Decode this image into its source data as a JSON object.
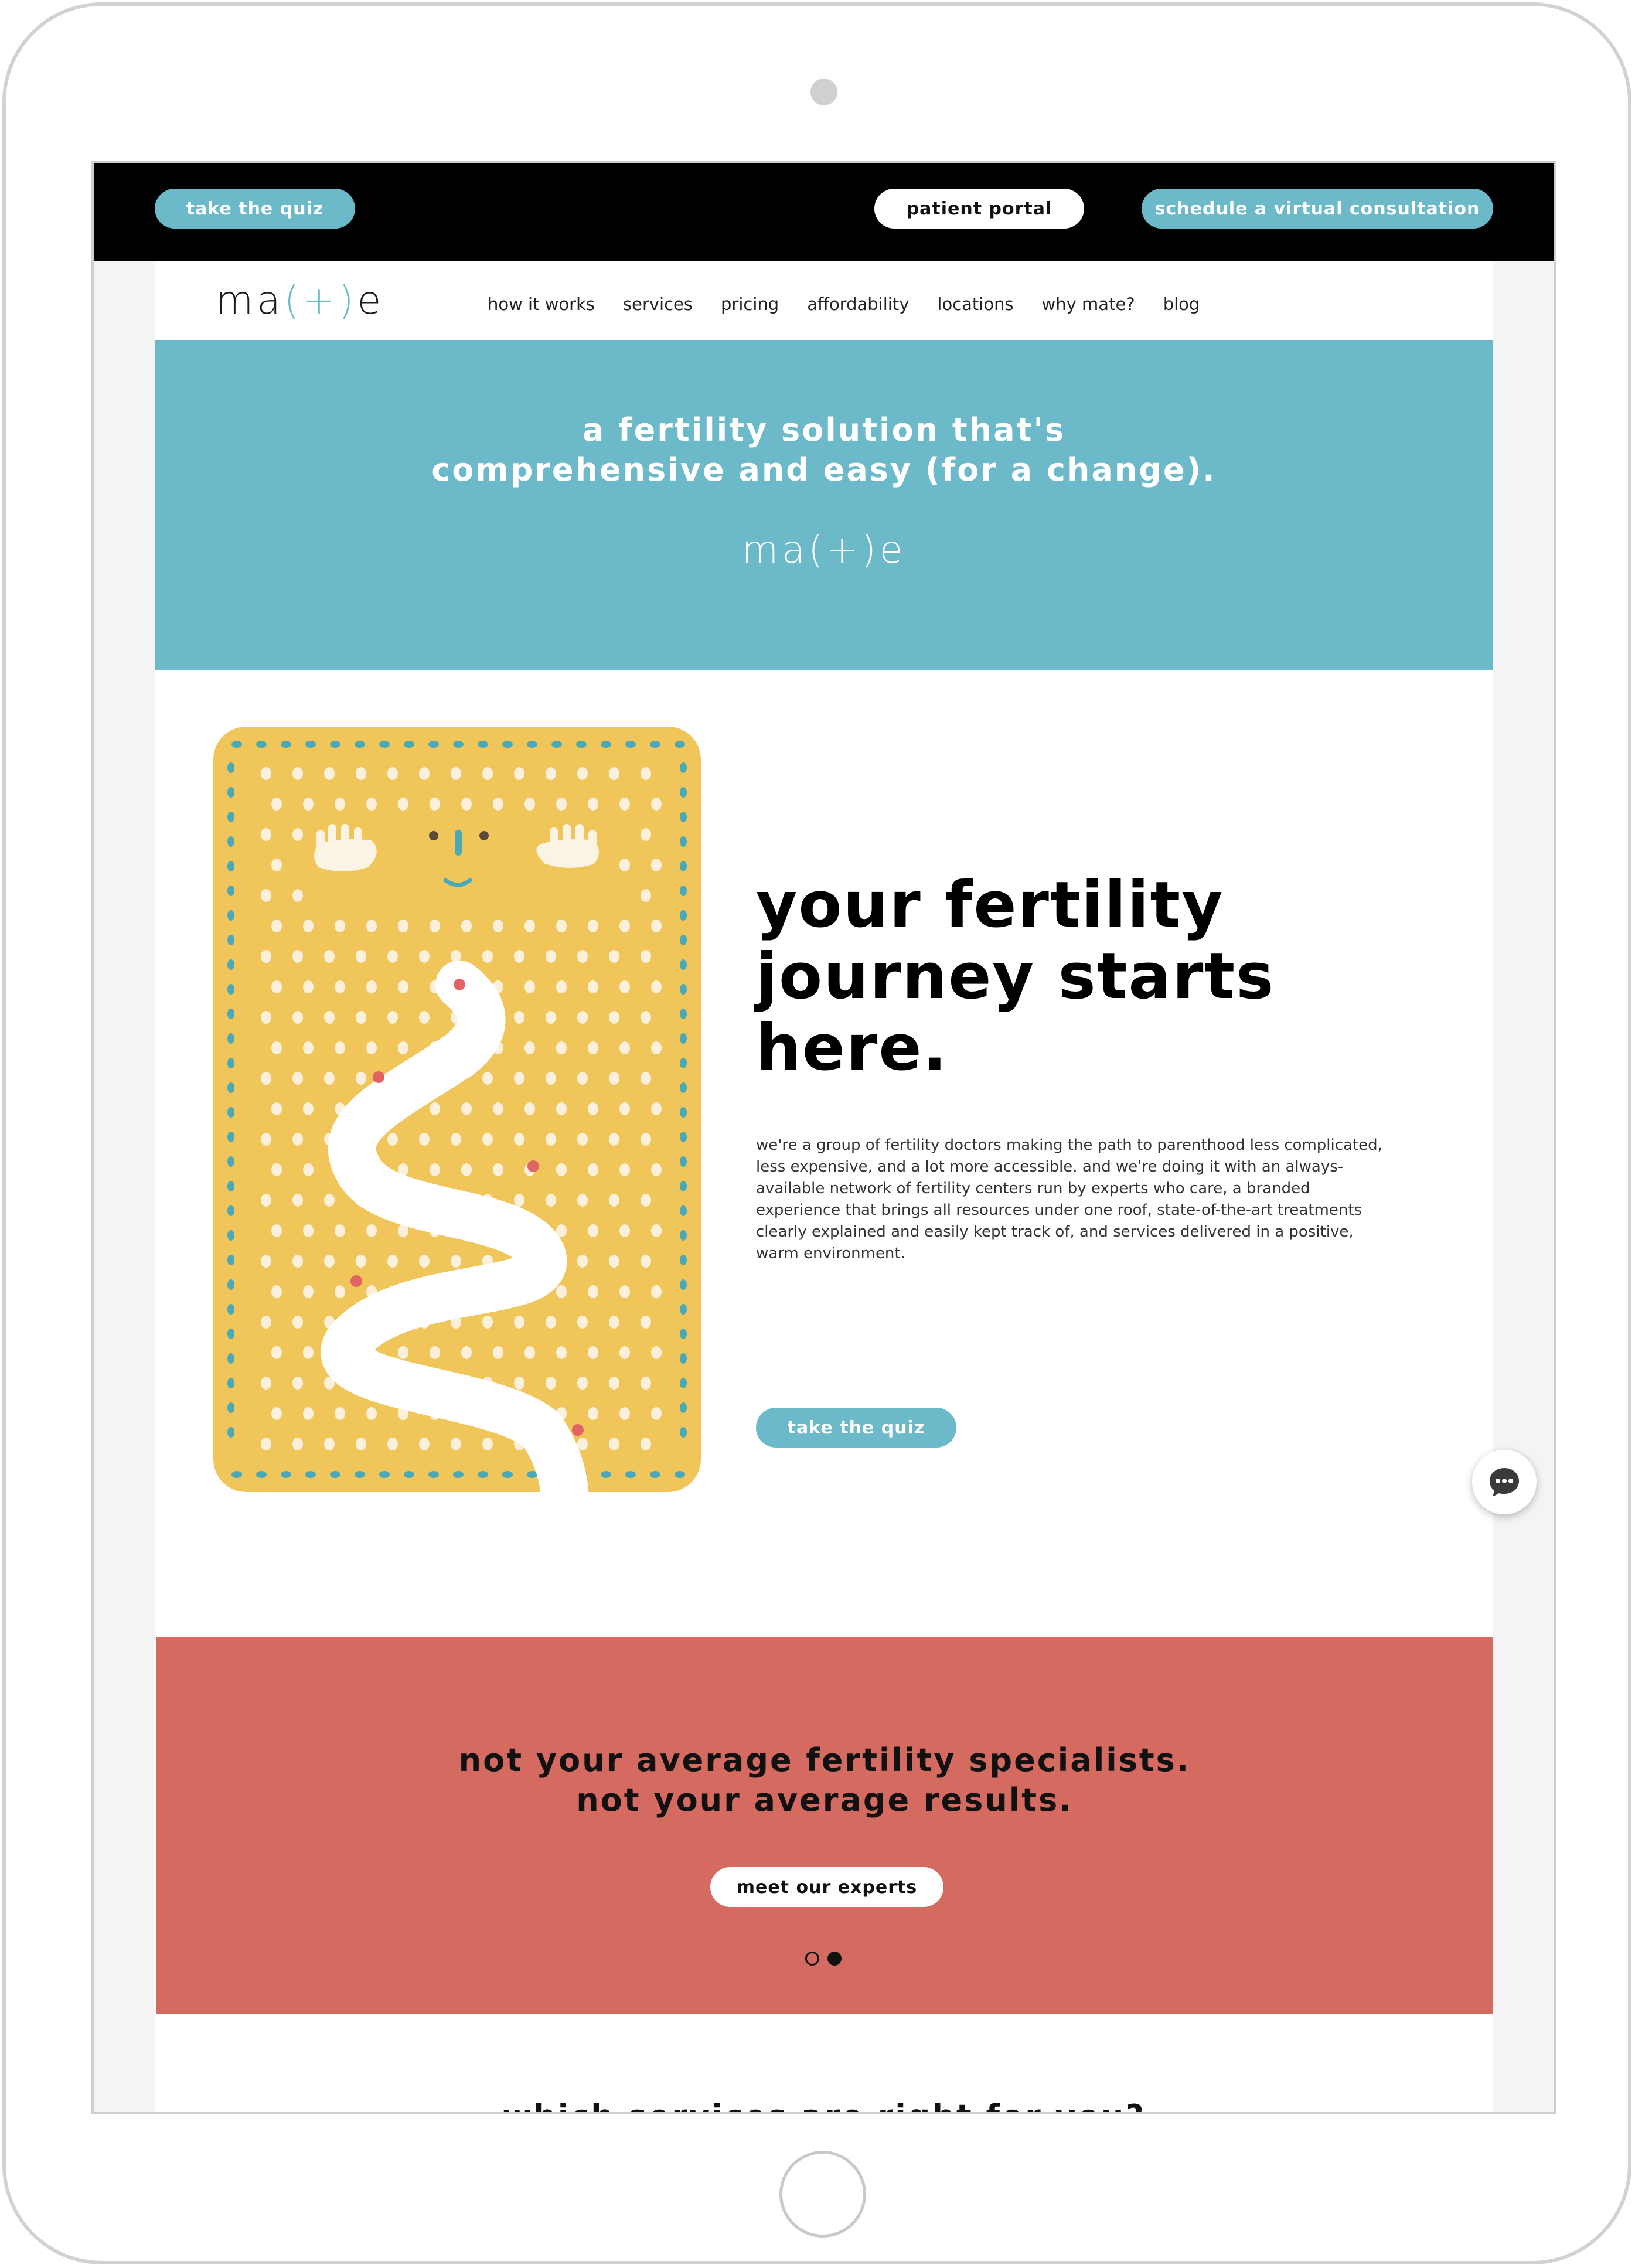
{
  "topbar": {
    "quiz_label": "take the quiz",
    "portal_label": "patient portal",
    "consult_label": "schedule a virtual consultation"
  },
  "nav": {
    "logo": {
      "prefix": "ma",
      "accent": "(+)",
      "suffix": "e"
    },
    "items": [
      "how it works",
      "services",
      "pricing",
      "affordability",
      "locations",
      "why mate?",
      "blog"
    ]
  },
  "hero": {
    "title_line1": "a fertility solution that's",
    "title_line2": "comprehensive and easy (for a change).",
    "logo": "ma(+)e"
  },
  "journey": {
    "title_line1": "your fertility",
    "title_line2": "journey starts",
    "title_line3": "here.",
    "copy": "we're a group of fertility doctors making the path to parenthood less complicated, less expensive, and a lot more accessible. and we're doing it with an always-available network of fertility centers run by experts who care, a branded experience that brings all resources under one roof, state-of-the-art treatments clearly explained and easily kept track of, and services delivered in a positive, warm environment.",
    "cta_label": "take the quiz"
  },
  "experts": {
    "title_line1": "not your average fertility specialists.",
    "title_line2": "not your average results.",
    "cta_label": "meet our experts",
    "slides_total": 2,
    "slide_active": 2
  },
  "services": {
    "title": "which services are right for you?"
  },
  "colors": {
    "teal": "#6cb9c9",
    "coral": "#d56a60",
    "mustard": "#f0c559",
    "black": "#000000"
  },
  "icons": {
    "chat": "chat-bubble-icon"
  }
}
